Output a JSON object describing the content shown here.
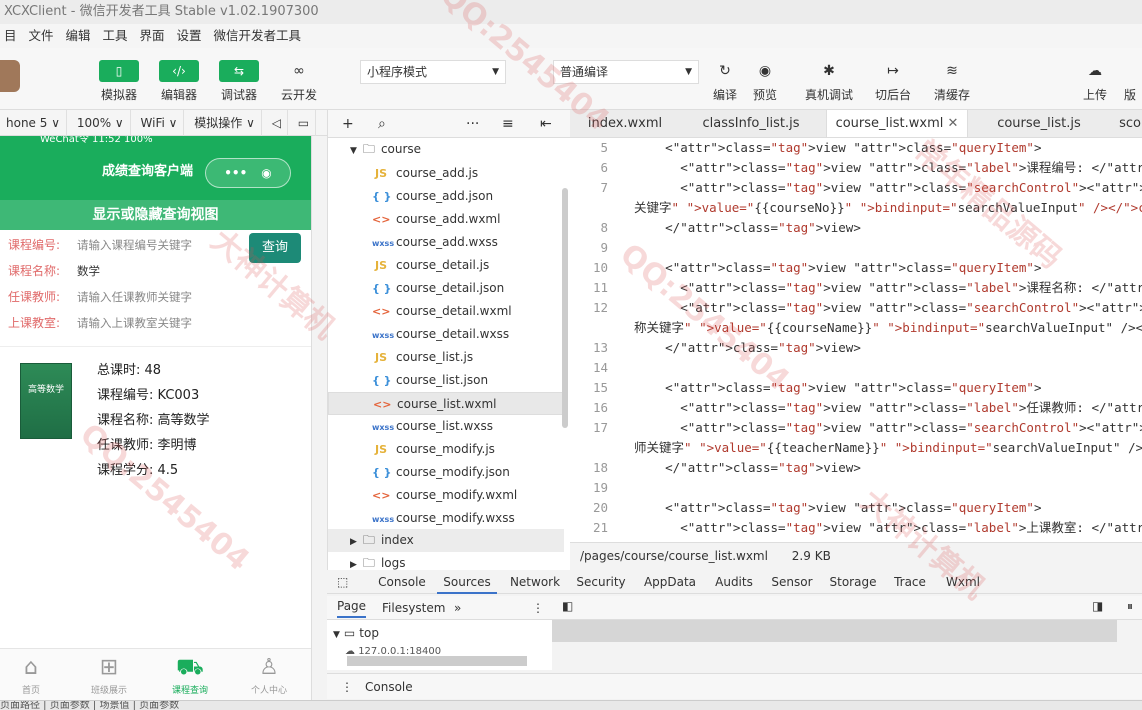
{
  "window": {
    "title": "XCXClient - 微信开发者工具 Stable v1.02.1907300"
  },
  "menu": [
    "目",
    "文件",
    "编辑",
    "工具",
    "界面",
    "设置",
    "微信开发者工具"
  ],
  "toolbar": {
    "simulator": "模拟器",
    "editor": "编辑器",
    "debugger": "调试器",
    "cloud": "云开发",
    "mode_select": "小程序模式",
    "compile_select": "普通编译",
    "compile": "编译",
    "preview": "预览",
    "real_debug": "真机调试",
    "background": "切后台",
    "clear_cache": "清缓存",
    "upload": "上传",
    "more": "版"
  },
  "device_bar": [
    "hone 5 ∨",
    "100% ∨",
    "WiFi ∨",
    "模拟操作 ∨"
  ],
  "phone": {
    "status": "WeChat令    11:52    100%",
    "nav_title": "成绩查询客户端",
    "caps_left": "•••",
    "caps_right": "◉",
    "band": "显示或隐藏查询视图",
    "query": [
      {
        "label": "课程编号:",
        "placeholder": "请输入课程编号关键字"
      },
      {
        "label": "课程名称:",
        "value": "数学"
      },
      {
        "label": "任课教师:",
        "placeholder": "请输入任课教师关键字"
      },
      {
        "label": "上课教室:",
        "placeholder": "请输入上课教室关键字"
      }
    ],
    "query_button": "查询",
    "course": {
      "book_title": "高等数学",
      "hours": "总课时: 48",
      "no": "课程编号: KC003",
      "name": "课程名称: 高等数学",
      "teacher": "任课教师: 李明博",
      "credit": "课程学分: 4.5"
    },
    "tabs": [
      {
        "label": "首页",
        "icon": "home-icon"
      },
      {
        "label": "班级展示",
        "icon": "grid-icon"
      },
      {
        "label": "课程查询",
        "icon": "cart-icon"
      },
      {
        "label": "个人中心",
        "icon": "person-icon"
      }
    ]
  },
  "tree": {
    "folder": "course",
    "files": [
      {
        "name": "course_add.js",
        "type": "js"
      },
      {
        "name": "course_add.json",
        "type": "json"
      },
      {
        "name": "course_add.wxml",
        "type": "wxml"
      },
      {
        "name": "course_add.wxss",
        "type": "wxss"
      },
      {
        "name": "course_detail.js",
        "type": "js"
      },
      {
        "name": "course_detail.json",
        "type": "json"
      },
      {
        "name": "course_detail.wxml",
        "type": "wxml"
      },
      {
        "name": "course_detail.wxss",
        "type": "wxss"
      },
      {
        "name": "course_list.js",
        "type": "js"
      },
      {
        "name": "course_list.json",
        "type": "json"
      },
      {
        "name": "course_list.wxml",
        "type": "wxml"
      },
      {
        "name": "course_list.wxss",
        "type": "wxss"
      },
      {
        "name": "course_modify.js",
        "type": "js"
      },
      {
        "name": "course_modify.json",
        "type": "json"
      },
      {
        "name": "course_modify.wxml",
        "type": "wxml"
      },
      {
        "name": "course_modify.wxss",
        "type": "wxss"
      }
    ],
    "index_folder": "index",
    "logs_folder": "logs"
  },
  "editor_tabs": [
    "index.wxml",
    "classInfo_list.js",
    "course_list.wxml",
    "course_list.js",
    "sco"
  ],
  "code": [
    {
      "n": "5",
      "t": "      <view class=\"queryItem\">"
    },
    {
      "n": "6",
      "t": "        <view class=\"label\">课程编号: </view>"
    },
    {
      "n": "7",
      "t": "        <view class=\"searchControl\"><input data-id=\"courseNo\" plac"
    },
    {
      "n": "",
      "t": "关键字\" value=\"{{courseNo}}\" bindinput=\"searchValueInput\" /></view>"
    },
    {
      "n": "8",
      "t": "      </view>"
    },
    {
      "n": "9",
      "t": ""
    },
    {
      "n": "10",
      "t": "      <view class=\"queryItem\">"
    },
    {
      "n": "11",
      "t": "        <view class=\"label\">课程名称: </view>"
    },
    {
      "n": "12",
      "t": "        <view class=\"searchControl\"><input data-id=\"courseName\" pl"
    },
    {
      "n": "",
      "t": "称关键字\" value=\"{{courseName}}\" bindinput=\"searchValueInput\" /></v"
    },
    {
      "n": "13",
      "t": "      </view>"
    },
    {
      "n": "14",
      "t": ""
    },
    {
      "n": "15",
      "t": "      <view class=\"queryItem\">"
    },
    {
      "n": "16",
      "t": "        <view class=\"label\">任课教师: </view>"
    },
    {
      "n": "17",
      "t": "        <view class=\"searchControl\"><input data-id=\"teacherName\" p"
    },
    {
      "n": "",
      "t": "师关键字\" value=\"{{teacherName}}\" bindinput=\"searchValueInput\" /><"
    },
    {
      "n": "18",
      "t": "      </view>"
    },
    {
      "n": "19",
      "t": ""
    },
    {
      "n": "20",
      "t": "      <view class=\"queryItem\">"
    },
    {
      "n": "21",
      "t": "        <view class=\"label\">上课教室: </view>"
    }
  ],
  "status": {
    "path": "/pages/course/course_list.wxml",
    "size": "2.9 KB"
  },
  "devtools_tabs": [
    "Console",
    "Sources",
    "Network",
    "Security",
    "AppData",
    "Audits",
    "Sensor",
    "Storage",
    "Trace",
    "Wxml"
  ],
  "sources": {
    "page": "Page",
    "filesystem": "Filesystem",
    "top": "top",
    "host": "127.0.0.1:18400"
  },
  "console_drawer": "Console",
  "bottom": "页面路径   |   页面参数   |   场景值   |   页面参数"
}
